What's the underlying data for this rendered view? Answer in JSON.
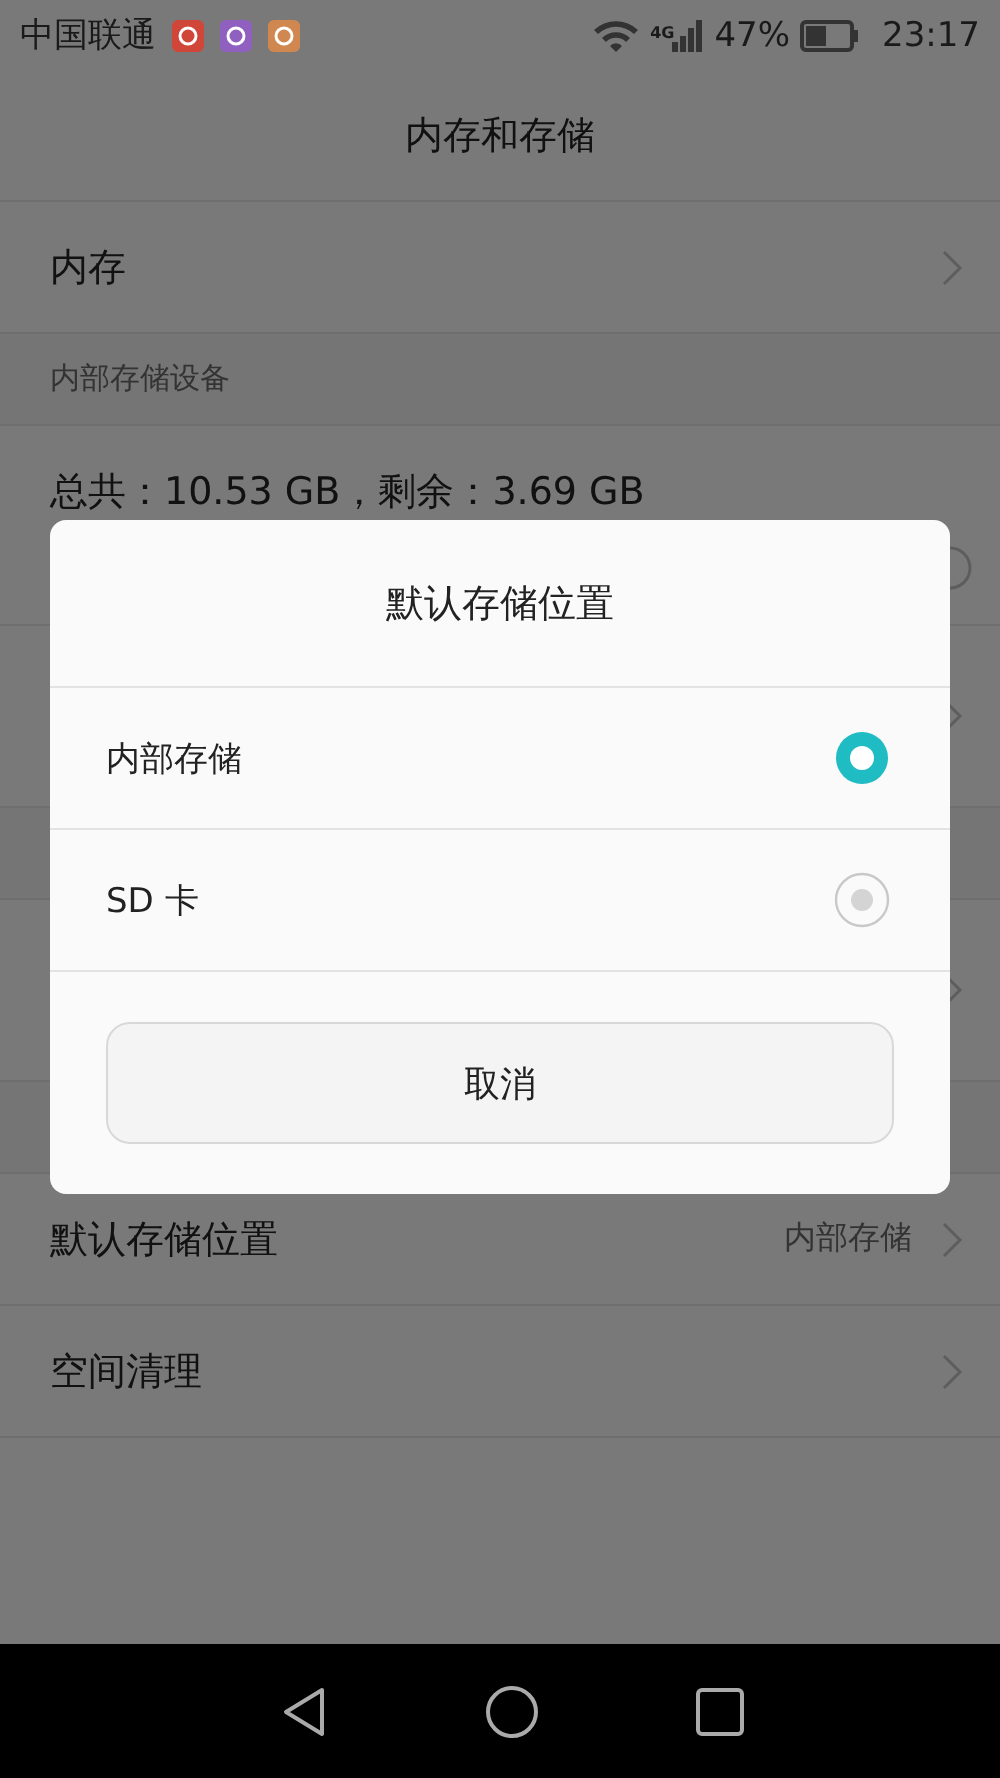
{
  "status_bar": {
    "carrier": "中国联通",
    "notifications": [
      {
        "color": "#d0473a"
      },
      {
        "color": "#9060c0"
      },
      {
        "color": "#d08850"
      }
    ],
    "network": "4G",
    "battery": "47%",
    "time": "23:17"
  },
  "title": "内存和存储",
  "items": [
    {
      "kind": "nav",
      "label": "内存"
    },
    {
      "kind": "header",
      "label": "内部存储设备"
    },
    {
      "kind": "storage",
      "label": "总共：10.53 GB，剩余：3.69 GB"
    },
    {
      "kind": "nav"
    },
    {
      "kind": "header"
    },
    {
      "kind": "nav"
    },
    {
      "kind": "header"
    },
    {
      "kind": "nav",
      "label": "默认存储位置",
      "value": "内部存储"
    },
    {
      "kind": "nav",
      "label": "空间清理"
    }
  ],
  "dialog": {
    "title": "默认存储位置",
    "options": [
      {
        "label": "内部存储",
        "selected": true
      },
      {
        "label": "SD 卡",
        "selected": false
      }
    ],
    "button": "取消"
  }
}
